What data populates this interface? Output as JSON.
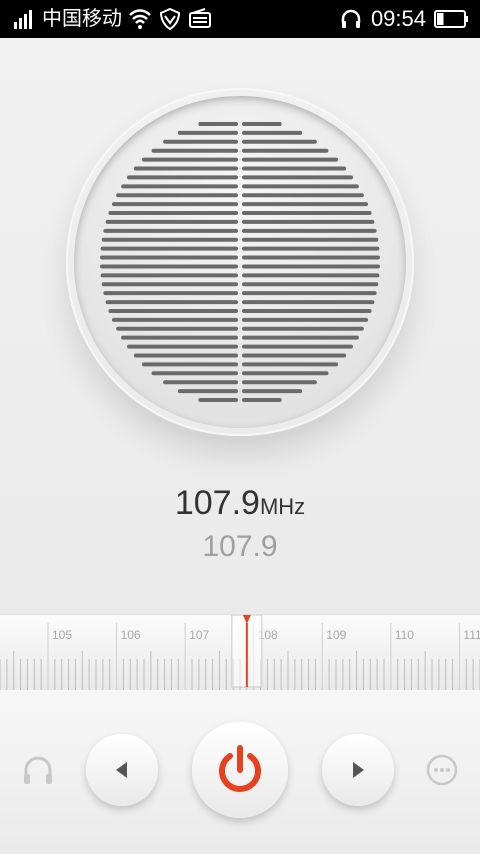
{
  "status_bar": {
    "carrier": "中国移动",
    "time": "09:54",
    "icons": [
      "signal-icon",
      "wifi-icon",
      "shield-icon",
      "radio-icon",
      "headphones-icon",
      "battery-icon"
    ],
    "battery_level": 0.25
  },
  "radio": {
    "frequency": "107.9",
    "unit": "MHz",
    "station": "107.9",
    "dial_labels": [
      "105",
      "106",
      "107",
      "108",
      "109",
      "110",
      "111"
    ],
    "dial_value": 107.9,
    "dial_min": 104.3,
    "dial_max": 111.3,
    "accent": "#e6421f"
  },
  "controls": {
    "headset_icon": "headset-icon",
    "prev_icon": "prev-icon",
    "power_icon": "power-icon",
    "next_icon": "next-icon",
    "more_icon": "more-icon"
  }
}
